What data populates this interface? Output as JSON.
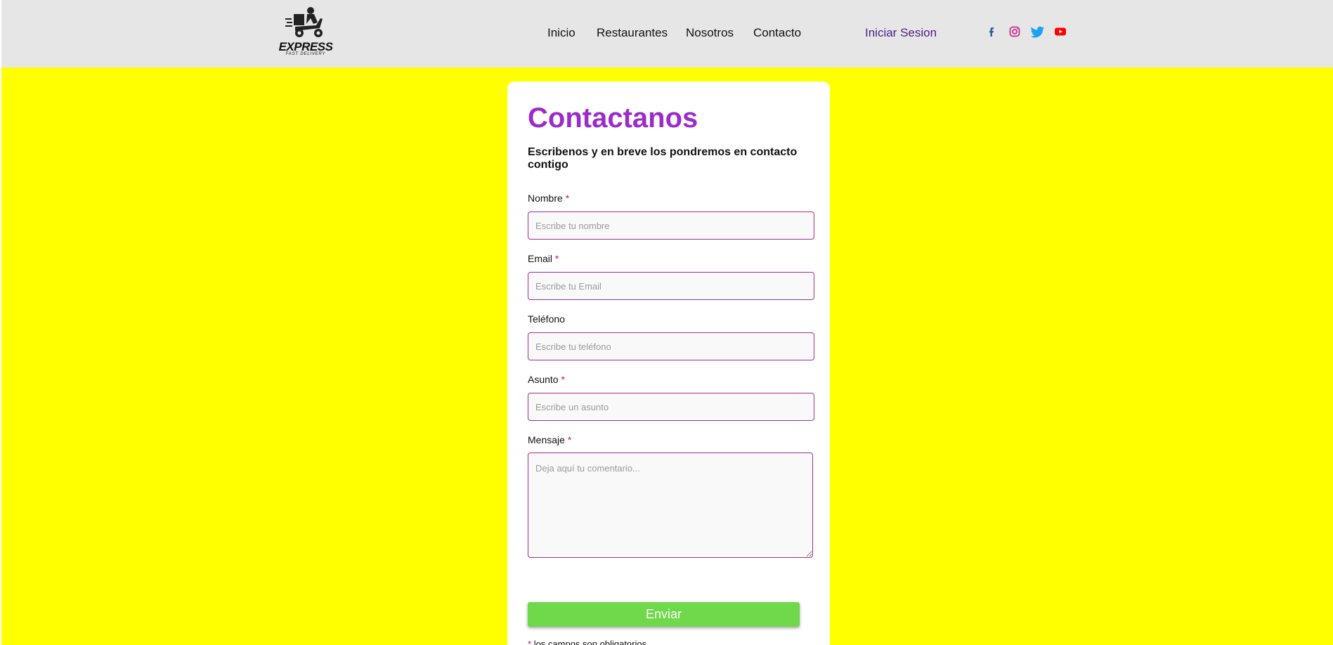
{
  "brand": {
    "name": "EXPRESS",
    "tagline": "FAST DELIVERY"
  },
  "nav": {
    "items": [
      "Inicio",
      "Restaurantes",
      "Nosotros",
      "Contacto"
    ],
    "login": "Iniciar Sesion"
  },
  "social": [
    {
      "icon": "facebook-icon",
      "color": "#3b5998"
    },
    {
      "icon": "instagram-icon",
      "color": "#c13584"
    },
    {
      "icon": "twitter-icon",
      "color": "#1da1f2"
    },
    {
      "icon": "youtube-icon",
      "color": "#ff0000"
    }
  ],
  "form": {
    "title": "Contactanos",
    "subtitle": "Escribenos y en breve los pondremos en contacto contigo",
    "required_mark": "*",
    "fields": [
      {
        "label": "Nombre",
        "placeholder": "Escribe tu nombre",
        "required": true,
        "value": ""
      },
      {
        "label": "Email",
        "placeholder": "Escribe tu Email",
        "required": true,
        "value": ""
      },
      {
        "label": "Teléfono",
        "placeholder": "Escribe tu teléfono",
        "required": false,
        "value": ""
      },
      {
        "label": "Asunto",
        "placeholder": "Escribe un asunto",
        "required": true,
        "value": ""
      }
    ],
    "message": {
      "label": "Mensaje",
      "placeholder": "Deja aquí tu comentario...",
      "required": true,
      "value": ""
    },
    "submit": "Enviar",
    "required_note": "los campos son obligatorios"
  },
  "colors": {
    "page_background": "#ffff00",
    "header_background": "#e6e6e6",
    "title": "#9b2cc9",
    "input_border": "#a0308f",
    "submit_button": "#6fd84b",
    "login_link": "#4b1f86"
  }
}
